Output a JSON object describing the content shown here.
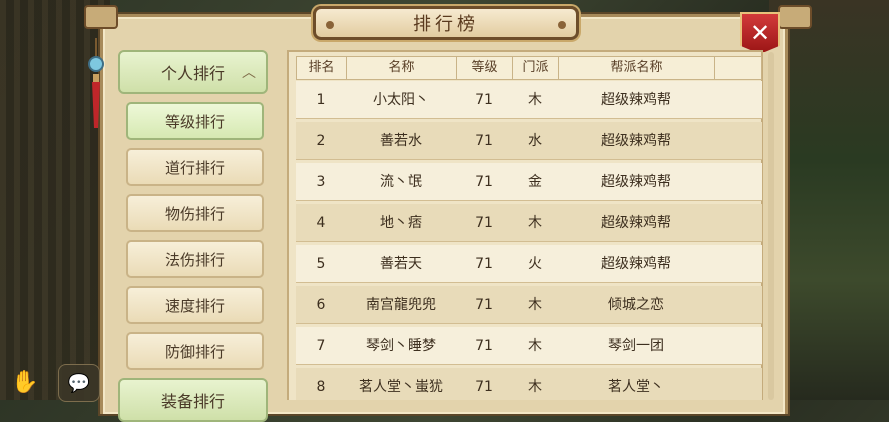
{
  "window": {
    "title": "排行榜"
  },
  "close_symbol": "✕",
  "sidebar": {
    "category": {
      "label": "个人排行",
      "chevron": "︿"
    },
    "items": [
      {
        "label": "等级排行",
        "active": true
      },
      {
        "label": "道行排行",
        "active": false
      },
      {
        "label": "物伤排行",
        "active": false
      },
      {
        "label": "法伤排行",
        "active": false
      },
      {
        "label": "速度排行",
        "active": false
      },
      {
        "label": "防御排行",
        "active": false
      }
    ],
    "next_category": {
      "label": "装备排行"
    }
  },
  "table": {
    "headers": [
      "排名",
      "名称",
      "等级",
      "门派",
      "帮派名称"
    ],
    "rows": [
      [
        "1",
        "小太阳丶",
        "71",
        "木",
        "超级辣鸡帮"
      ],
      [
        "2",
        "善若水",
        "71",
        "水",
        "超级辣鸡帮"
      ],
      [
        "3",
        "流丶氓",
        "71",
        "金",
        "超级辣鸡帮"
      ],
      [
        "4",
        "地丶痞",
        "71",
        "木",
        "超级辣鸡帮"
      ],
      [
        "5",
        "善若天",
        "71",
        "火",
        "超级辣鸡帮"
      ],
      [
        "6",
        "南宫龍兜兜",
        "71",
        "木",
        "倾城之恋"
      ],
      [
        "7",
        "琴剑丶睡梦",
        "71",
        "木",
        "琴剑一团"
      ],
      [
        "8",
        "茗人堂丶蚩犹",
        "71",
        "木",
        "茗人堂丶"
      ]
    ]
  },
  "icons": {
    "chat": "chat-bubble-icon",
    "hand": "hand-icon",
    "charm": "charm-tassel-icon",
    "close": "close-icon"
  },
  "colors": {
    "accent_red": "#b82020",
    "panel": "#e3d3ac",
    "active_tab": "#d6e9b2"
  }
}
